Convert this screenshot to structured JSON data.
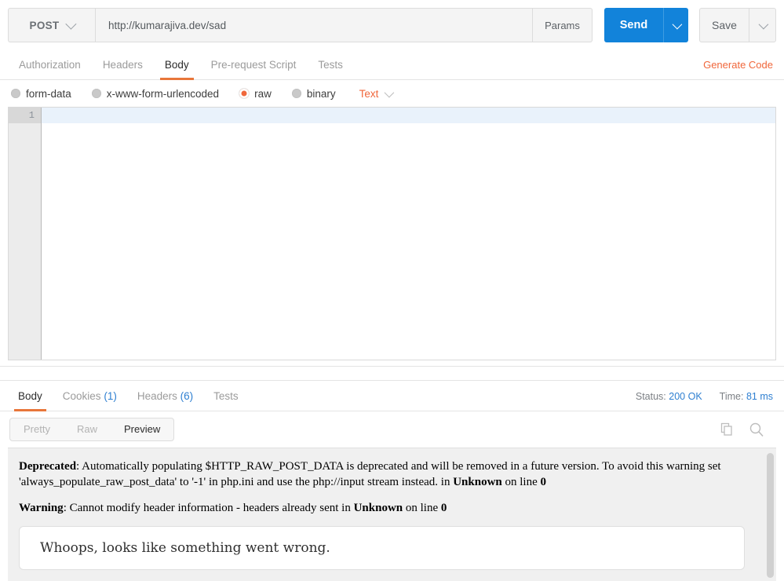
{
  "request": {
    "method": "POST",
    "method_caret_icon": "chevron-down-icon",
    "url_value": "http://kumarajiva.dev/sad",
    "url_placeholder": "Enter request URL",
    "params_label": "Params",
    "send_label": "Send",
    "send_caret_icon": "chevron-down-icon",
    "save_label": "Save",
    "save_caret_icon": "chevron-down-icon",
    "tabs": [
      {
        "label": "Authorization",
        "active": false
      },
      {
        "label": "Headers",
        "active": false
      },
      {
        "label": "Body",
        "active": true
      },
      {
        "label": "Pre-request Script",
        "active": false
      },
      {
        "label": "Tests",
        "active": false
      }
    ],
    "generate_code_label": "Generate Code",
    "body_types": [
      {
        "label": "form-data",
        "checked": false
      },
      {
        "label": "x-www-form-urlencoded",
        "checked": false
      },
      {
        "label": "raw",
        "checked": true
      },
      {
        "label": "binary",
        "checked": false
      }
    ],
    "raw_format_label": "Text",
    "raw_format_caret_icon": "chevron-down-icon",
    "editor": {
      "line_numbers": [
        "1"
      ],
      "content": ""
    }
  },
  "response": {
    "tabs": [
      {
        "label": "Body",
        "count": "",
        "active": true
      },
      {
        "label": "Cookies",
        "count": "(1)",
        "active": false
      },
      {
        "label": "Headers",
        "count": "(6)",
        "active": false
      },
      {
        "label": "Tests",
        "count": "",
        "active": false
      }
    ],
    "status_label": "Status:",
    "status_value": "200 OK",
    "time_label": "Time:",
    "time_value": "81 ms",
    "format_modes": [
      {
        "label": "Pretty",
        "active": false
      },
      {
        "label": "Raw",
        "active": false
      },
      {
        "label": "Preview",
        "active": true
      }
    ],
    "copy_icon": "copy-icon",
    "search_icon": "search-icon",
    "body": {
      "messages": [
        {
          "level": "Deprecated",
          "text_before": ": Automatically populating $HTTP_RAW_POST_DATA is deprecated and will be removed in a future version. To avoid this warning set 'always_populate_raw_post_data' to '-1' in php.ini and use the php://input stream instead. in ",
          "location": "Unknown",
          "text_mid": " on line ",
          "line": "0"
        },
        {
          "level": "Warning",
          "text_before": ": Cannot modify header information - headers already sent in ",
          "location": "Unknown",
          "text_mid": " on line ",
          "line": "0"
        }
      ],
      "whoops_text": "Whoops, looks like something went wrong."
    }
  },
  "colors": {
    "accent_orange": "#f0673b",
    "accent_blue": "#1283da",
    "link_blue": "#2e7fd1"
  }
}
